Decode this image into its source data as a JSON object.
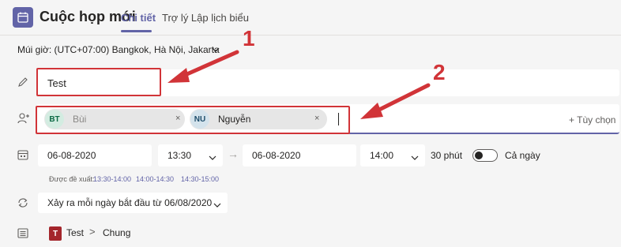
{
  "header": {
    "title": "Cuộc họp mới",
    "tabs": [
      {
        "label": "Chi tiết",
        "active": true
      },
      {
        "label": "Trợ lý Lập lịch biểu",
        "active": false
      }
    ]
  },
  "timezone": {
    "label": "Múi giờ: (UTC+07:00) Bangkok, Hà Nội, Jakarta"
  },
  "meeting_title": {
    "value": "Test"
  },
  "attendees": {
    "people": [
      {
        "initials": "BT",
        "name": "Bùi",
        "avatar_bg": "#d3ece1",
        "avatar_fg": "#0e6b46"
      },
      {
        "initials": "NU",
        "name": "Nguyễn",
        "avatar_bg": "#d4e3ec",
        "avatar_fg": "#1f4e6b"
      }
    ],
    "remove_glyph": "×",
    "options_label": "+ Tùy chọn"
  },
  "schedule": {
    "start_date": "06-08-2020",
    "start_time": "13:30",
    "arrow": "→",
    "end_date": "06-08-2020",
    "end_time": "14:00",
    "duration": "30 phút",
    "all_day_label": "Cả ngày",
    "all_day_on": false
  },
  "suggestions": {
    "label": "Được đề xuất:",
    "slots": [
      "13:30-14:00",
      "14:00-14:30",
      "14:30-15:00"
    ]
  },
  "recurrence": {
    "value": "Xảy ra mỗi ngày bắt đầu từ 06/08/2020"
  },
  "channel": {
    "badge": "T",
    "team": "Test",
    "separator": ">",
    "name": "Chung"
  },
  "annotations": {
    "callout_1": "1",
    "callout_2": "2",
    "color": "#d13438"
  },
  "colors": {
    "accent": "#6264a7",
    "background": "#f5f5f5",
    "field": "#ffffff",
    "annotation": "#d13438"
  },
  "icons": [
    "calendar-app-icon",
    "chevron-down-icon",
    "pencil-icon",
    "add-person-icon",
    "calendar-icon",
    "repeat-icon",
    "channel-list-icon"
  ]
}
